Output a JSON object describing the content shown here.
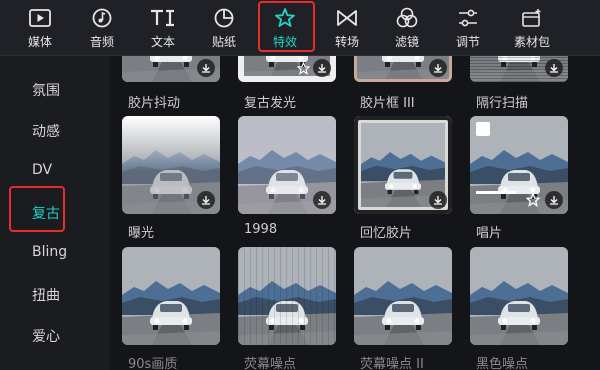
{
  "toolbar": {
    "items": [
      {
        "label": "媒体",
        "icon": "play-square-icon"
      },
      {
        "label": "音频",
        "icon": "music-note-icon"
      },
      {
        "label": "文本",
        "icon": "text-ti-icon"
      },
      {
        "label": "贴纸",
        "icon": "sticker-icon"
      },
      {
        "label": "特效",
        "icon": "sparkle-star-icon",
        "active": true
      },
      {
        "label": "转场",
        "icon": "transition-bowtie-icon"
      },
      {
        "label": "滤镜",
        "icon": "filter-circles-icon"
      },
      {
        "label": "调节",
        "icon": "sliders-icon"
      },
      {
        "label": "素材包",
        "icon": "material-package-icon"
      }
    ]
  },
  "sidebar": {
    "items": [
      {
        "label": "氛围"
      },
      {
        "label": "动感"
      },
      {
        "label": "DV"
      },
      {
        "label": "复古",
        "active": true
      },
      {
        "label": "Bling"
      },
      {
        "label": "扭曲"
      },
      {
        "label": "爱心"
      }
    ]
  },
  "effects": {
    "row1": [
      "胶片抖动",
      "复古发光",
      "胶片框 III",
      "隔行扫描"
    ],
    "row2": [
      "曝光",
      "1998",
      "回忆胶片",
      "唱片"
    ],
    "row3": [
      "90s画质",
      "荧幕噪点",
      "荧幕噪点 II",
      "黑色噪点"
    ]
  },
  "colors": {
    "accent": "#24d3c6",
    "highlight_box": "#e62e2e"
  }
}
